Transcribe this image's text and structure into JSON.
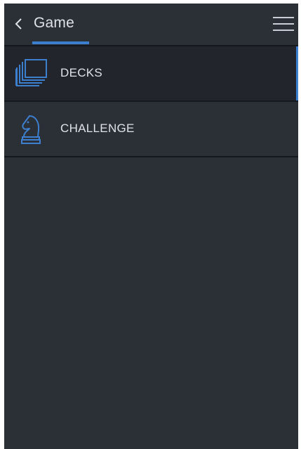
{
  "header": {
    "title": "Game",
    "back_icon": "chevron-left-icon",
    "menu_icon": "hamburger-menu-icon"
  },
  "items": [
    {
      "label": "DECKS",
      "icon": "cards-stack-icon",
      "active": true
    },
    {
      "label": "CHALLENGE",
      "icon": "chess-knight-icon",
      "active": false
    }
  ],
  "colors": {
    "background": "#2b2f36",
    "active_item": "#22262c",
    "accent": "#3d7fcf",
    "text": "#dfe3e8",
    "divider": "#15181c"
  }
}
